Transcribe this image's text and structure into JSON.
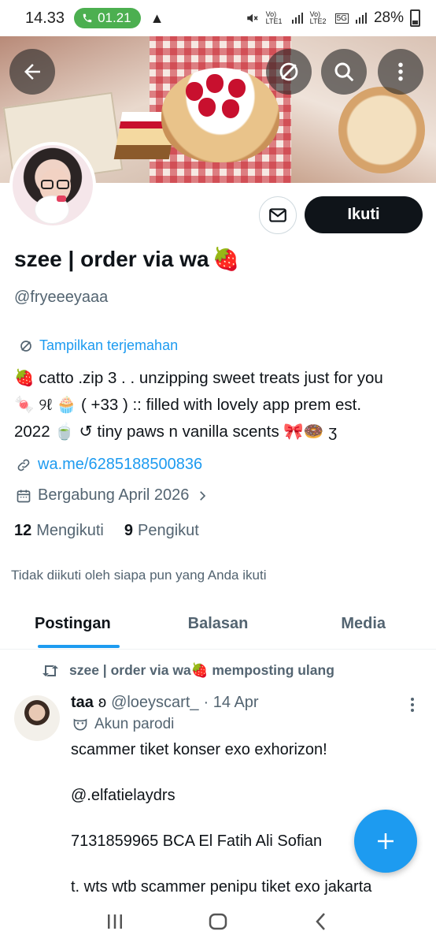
{
  "status_bar": {
    "time": "14.33",
    "call_timer": "01.21",
    "warning": "▲",
    "signal1": "Vo) LTE1",
    "signal2": "Vo) LTE2",
    "network": "5G",
    "battery": "28%"
  },
  "banner": {
    "back_icon": "arrow-left-icon",
    "translate_off_icon": "translate-off-icon",
    "search_icon": "search-icon",
    "more_icon": "more-vertical-icon"
  },
  "profile": {
    "name": "szee | order via wa",
    "name_emoji": "🍓",
    "handle": "@fryeeeyaaa",
    "follow_label": "Ikuti",
    "translate_label": "Tampilkan terjemahan",
    "bio_lines": [
      "🍓 catto .zip 3 . . unzipping sweet treats just for you",
      "🍬 ୨ℓ 🧁 ( +33 ) :: filled with lovely app prem est.",
      "2022 🍵 ↺ tiny paws n vanilla scents 🎀🍩 ʒ"
    ],
    "link": "wa.me/6285188500836",
    "joined": "Bergabung April 2026",
    "following_count": "12",
    "following_label": "Mengikuti",
    "followers_count": "9",
    "followers_label": "Pengikut",
    "not_followed_note": "Tidak diikuti oleh siapa pun yang Anda ikuti"
  },
  "tabs": [
    {
      "label": "Postingan",
      "active": true
    },
    {
      "label": "Balasan",
      "active": false
    },
    {
      "label": "Media",
      "active": false
    }
  ],
  "post": {
    "repost_by": "szee | order via wa🍓 memposting ulang",
    "author_name": "taa",
    "author_badge": "ʚ",
    "author_handle": "@loeyscart_",
    "date": "· 14 Apr",
    "parody_label": "Akun parodi",
    "lines": [
      "scammer tiket konser exo exhorizon!",
      "@.elfatielaydrs",
      "7131859965 BCA El Fatih Ali Sofian",
      "t. wts wtb scammer penipu tiket exo jakarta"
    ]
  },
  "colors": {
    "accent": "#1d9bf0",
    "text": "#0f1419",
    "muted": "#536471",
    "follow_button": "#0f1419"
  }
}
